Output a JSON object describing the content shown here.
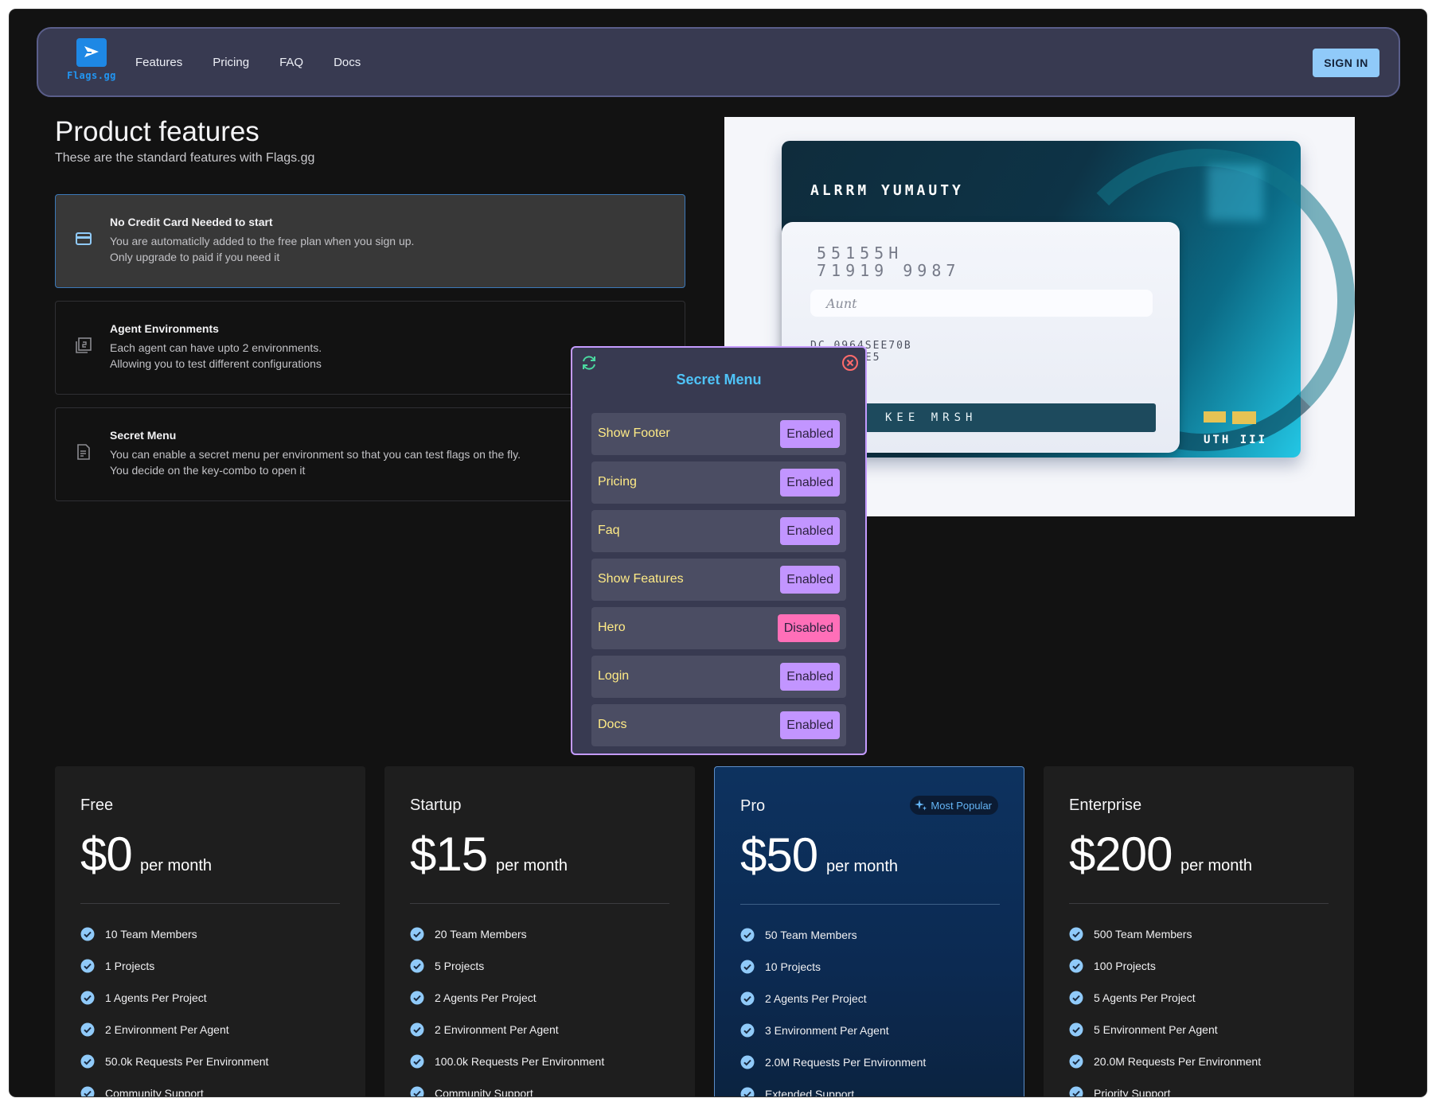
{
  "header": {
    "logo_text": "Flags.gg",
    "nav": [
      "Features",
      "Pricing",
      "FAQ",
      "Docs"
    ],
    "sign_in": "SIGN IN"
  },
  "features": {
    "title": "Product features",
    "subtitle": "These are the standard features with Flags.gg",
    "items": [
      {
        "name": "No Credit Card Needed to start",
        "line1": "You are automaticlly added to the free plan when you sign up.",
        "line2": "Only upgrade to paid if you need it",
        "icon": "credit-card-icon"
      },
      {
        "name": "Agent Environments",
        "line1": "Each agent can have upto 2 environments.",
        "line2": "Allowing you to test different configurations",
        "icon": "filter-2-icon"
      },
      {
        "name": "Secret Menu",
        "line1": "You can enable a secret menu per environment so that you can test flags on the fly.",
        "line2": "You decide on the key-combo to open it",
        "icon": "document-icon"
      }
    ]
  },
  "card_art": {
    "title": "ALRRM YUMAUTY",
    "number_l1": "55155H",
    "number_l2": "71919 9987",
    "field": "Aunt",
    "small_l1": "DC 0964SEE70B",
    "small_l2": "59 6I8EE5",
    "bar": "KEE  MRSH",
    "corner": "UTH III"
  },
  "secret_menu": {
    "title": "Secret Menu",
    "items": [
      {
        "label": "Show Footer",
        "state": "Enabled"
      },
      {
        "label": "Pricing",
        "state": "Enabled"
      },
      {
        "label": "Faq",
        "state": "Enabled"
      },
      {
        "label": "Show Features",
        "state": "Enabled"
      },
      {
        "label": "Hero",
        "state": "Disabled"
      },
      {
        "label": "Login",
        "state": "Enabled"
      },
      {
        "label": "Docs",
        "state": "Enabled"
      }
    ]
  },
  "pricing": {
    "per_month": "per month",
    "badge": "Most Popular",
    "plans": [
      {
        "name": "Free",
        "price": "$0",
        "features": [
          "10 Team Members",
          "1 Projects",
          "1 Agents Per Project",
          "2 Environment Per Agent",
          "50.0k Requests Per Environment",
          "Community Support"
        ]
      },
      {
        "name": "Startup",
        "price": "$15",
        "features": [
          "20 Team Members",
          "5 Projects",
          "2 Agents Per Project",
          "2 Environment Per Agent",
          "100.0k Requests Per Environment",
          "Community Support"
        ]
      },
      {
        "name": "Pro",
        "price": "$50",
        "features": [
          "50 Team Members",
          "10 Projects",
          "2 Agents Per Project",
          "3 Environment Per Agent",
          "2.0M Requests Per Environment",
          "Extended Support"
        ]
      },
      {
        "name": "Enterprise",
        "price": "$200",
        "features": [
          "500 Team Members",
          "100 Projects",
          "5 Agents Per Project",
          "5 Environment Per Agent",
          "20.0M Requests Per Environment",
          "Priority Support"
        ]
      }
    ]
  },
  "colors": {
    "accent": "#90caf9",
    "menu_enabled": "#c295ff",
    "menu_disabled": "#ff6fb8",
    "menu_label": "#ffeb86",
    "menu_title": "#4fc3f7"
  }
}
